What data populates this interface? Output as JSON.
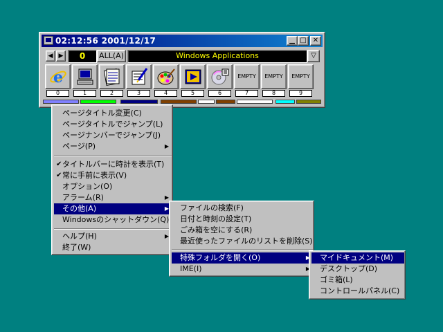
{
  "window": {
    "title": "02:12:56   2001/12/17",
    "min": "▁",
    "max": "□",
    "close": "✕",
    "prev": "◀",
    "next": "▶",
    "page_number": "0",
    "all_label": "ALL(A)",
    "group_name": "Windows Applications",
    "dropdown": "▽"
  },
  "slots": [
    {
      "num": "0",
      "icon": "internet-explorer-icon"
    },
    {
      "num": "1",
      "icon": "computer-icon"
    },
    {
      "num": "2",
      "icon": "notepad-icon"
    },
    {
      "num": "3",
      "icon": "wordpad-icon"
    },
    {
      "num": "4",
      "icon": "paint-icon"
    },
    {
      "num": "5",
      "icon": "media-player-icon"
    },
    {
      "num": "6",
      "icon": "cd-player-icon"
    },
    {
      "num": "7",
      "label": "EMPTY"
    },
    {
      "num": "8",
      "label": "EMPTY"
    },
    {
      "num": "9",
      "label": "EMPTY"
    }
  ],
  "colors": [
    "#8080ff",
    "#00ff00",
    "#000080",
    "#804000",
    "#ffffff",
    "#804000",
    "#ffffff",
    "#00ffff",
    "#808000"
  ],
  "menu_main": {
    "items": [
      "ページタイトル変更(C)",
      "ページタイトルでジャンプ(L)",
      "ページナンバーでジャンプ(J)",
      "ページ(P)",
      "タイトルバーに時計を表示(T)",
      "常に手前に表示(V)",
      "オプション(O)",
      "アラーム(R)",
      "その他(A)",
      "Windowsのシャットダウン(Q)",
      "ヘルプ(H)",
      "終了(W)"
    ],
    "check": "✔",
    "arrow": "▶"
  },
  "menu_other": {
    "items": [
      "ファイルの検索(F)",
      "日付と時刻の設定(T)",
      "ごみ箱を空にする(R)",
      "最近使ったファイルのリストを削除(S)",
      "特殊フォルダを開く(O)",
      "IME(I)"
    ]
  },
  "menu_special": {
    "items": [
      "マイドキュメント(M)",
      "デスクトップ(D)",
      "ゴミ箱(L)",
      "コントロールパネル(C)"
    ]
  }
}
